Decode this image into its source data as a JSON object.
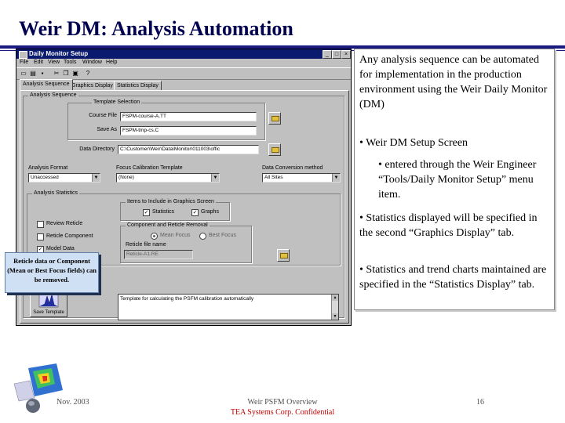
{
  "slide": {
    "title": "Weir DM: Analysis Automation"
  },
  "window": {
    "title": "Daily Monitor Setup",
    "controls": {
      "minimize": "_",
      "maximize": "□",
      "close": "×"
    },
    "menu": [
      "File",
      "Edit",
      "View",
      "Tools",
      "Window",
      "Help"
    ],
    "tabs": [
      "Analysis Sequence",
      "Graphics Display",
      "Statistics Display"
    ],
    "analysis_group": "Analysis Sequence",
    "template_group": "Template Selection",
    "course_file_label": "Course File",
    "course_file_value": "FSPM-course-A.TT",
    "save_as_label": "Save As",
    "save_as_value": "FSPM-tmp-cs.C",
    "data_dir_label": "Data Directory",
    "data_dir_value": "C:\\Customer\\Weir\\Data\\Monitor\\011003\\offic",
    "analysis_format_label": "Analysis Format",
    "analysis_format_value": "Unaccessed",
    "focus_cal_label": "Focus Calibration Template",
    "focus_cal_value": "(None)",
    "data_conv_label": "Data Conversion method",
    "data_conv_value": "All Sites",
    "stats_group": "Analysis Statistics",
    "checkboxes": [
      {
        "label": "Review Reticle",
        "checked": false
      },
      {
        "label": "Reticle Component",
        "checked": false
      },
      {
        "label": "Model Data",
        "checked": true
      }
    ],
    "include_group": "Items to Include in Graphics Screen",
    "include_items": [
      {
        "label": "Statistics",
        "checked": true
      },
      {
        "label": "Graphs",
        "checked": true
      }
    ],
    "removal_group": "Component and Reticle Removal",
    "removal_options": [
      {
        "label": "Mean Focus",
        "selected": true
      },
      {
        "label": "Best Focus",
        "selected": false
      }
    ],
    "reticle_file_label": "Reticle file name",
    "reticle_file_value": "Reticle-A1.RE",
    "description": "Template for calculating the PSFM calibration automatically",
    "run_button": "Save Template"
  },
  "callout": "Reticle data or Component (Mean or Best Focus fields) can be removed.",
  "bullets": [
    {
      "level": 0,
      "bullet": "",
      "text": "Any analysis sequence can be automated for implementation in the production environment using the Weir Daily Monitor (DM)"
    },
    {
      "level": 0,
      "bullet": "•",
      "text": "Weir DM Setup Screen"
    },
    {
      "level": 1,
      "bullet": "•",
      "text": "entered through the Weir Engineer “Tools/Daily Monitor Setup” menu item."
    },
    {
      "level": 0,
      "bullet": "•",
      "text": "Statistics displayed will be specified in the second “Graphics Display” tab."
    },
    {
      "level": 0,
      "bullet": "•",
      "text": "Statistics and trend charts maintained are specified in the “Statistics Display” tab."
    }
  ],
  "footer": {
    "date": "Nov. 2003",
    "center_line1": "Weir PSFM Overview",
    "center_line2": "TEA Systems Corp. Confidential",
    "page": "16"
  },
  "colors": {
    "title": "#000050",
    "titlebar": "#0a1a6e",
    "callout_bg": "#d0e0f4",
    "confidential": "#c00000"
  }
}
